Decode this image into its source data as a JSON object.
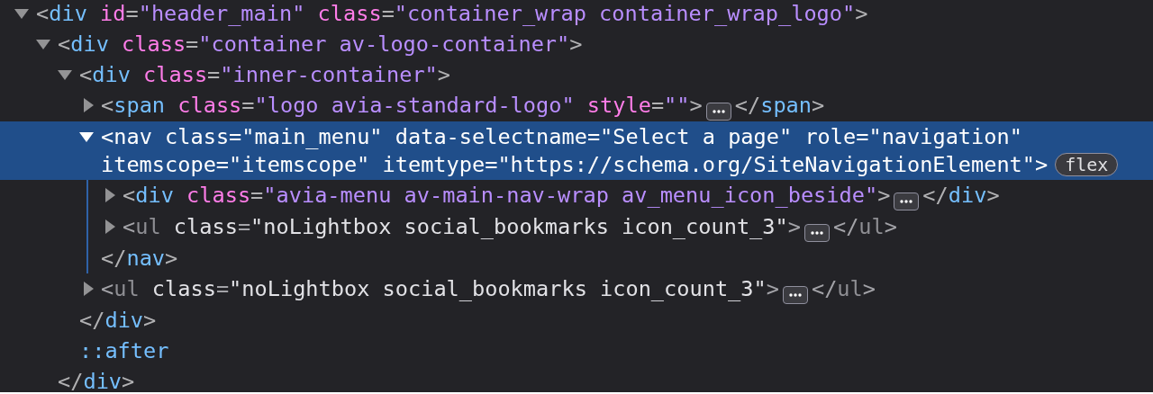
{
  "tree": [
    {
      "kind": "element",
      "lt": "<",
      "tag": "div",
      "gt": ">",
      "expanded": true,
      "selected": false,
      "dimmed": false,
      "attributes": [
        {
          "name": "id",
          "sign": "=",
          "value": "\"header_main\""
        },
        {
          "name": "class",
          "sign": "=",
          "value": "\"container_wrap container_wrap_logo\""
        }
      ],
      "children": [
        {
          "kind": "element",
          "lt": "<",
          "tag": "div",
          "gt": ">",
          "expanded": true,
          "selected": false,
          "dimmed": false,
          "attributes": [
            {
              "name": "class",
              "sign": "=",
              "value": "\"container av-logo-container\""
            }
          ],
          "closing": {
            "lt": "</",
            "tag": "div",
            "gt": ">"
          },
          "children": [
            {
              "kind": "element",
              "lt": "<",
              "tag": "div",
              "gt": ">",
              "expanded": true,
              "selected": false,
              "dimmed": false,
              "attributes": [
                {
                  "name": "class",
                  "sign": "=",
                  "value": "\"inner-container\""
                }
              ],
              "closing": {
                "lt": "</",
                "tag": "div",
                "gt": ">"
              },
              "children": [
                {
                  "kind": "element",
                  "lt": "<",
                  "tag": "span",
                  "gt": ">",
                  "expanded": false,
                  "selected": false,
                  "dimmed": false,
                  "attributes": [
                    {
                      "name": "class",
                      "sign": "=",
                      "value": "\"logo avia-standard-logo\""
                    },
                    {
                      "name": "style",
                      "sign": "=",
                      "value": "\"\""
                    }
                  ],
                  "closing": {
                    "lt": "</",
                    "tag": "span",
                    "gt": ">"
                  }
                },
                {
                  "kind": "element",
                  "lt": "<",
                  "tag": "nav",
                  "gt": ">",
                  "expanded": true,
                  "selected": true,
                  "dimmed": false,
                  "badge": "flex",
                  "attributes": [
                    {
                      "name": "class",
                      "sign": "=",
                      "value": "\"main_menu\""
                    },
                    {
                      "name": "data-selectname",
                      "sign": "=",
                      "value": "\"Select a page\""
                    },
                    {
                      "name": "role",
                      "sign": "=",
                      "value": "\"navigation\""
                    },
                    {
                      "name": "itemscope",
                      "sign": "=",
                      "value": "\"itemscope\""
                    },
                    {
                      "name": "itemtype",
                      "sign": "=",
                      "value": "\"https://schema.org/SiteNavigationElement\""
                    }
                  ],
                  "closing": {
                    "lt": "</",
                    "tag": "nav",
                    "gt": ">"
                  },
                  "children": [
                    {
                      "kind": "element",
                      "lt": "<",
                      "tag": "div",
                      "gt": ">",
                      "expanded": false,
                      "selected": false,
                      "dimmed": false,
                      "attributes": [
                        {
                          "name": "class",
                          "sign": "=",
                          "value": "\"avia-menu av-main-nav-wrap av_menu_icon_beside\""
                        }
                      ],
                      "closing": {
                        "lt": "</",
                        "tag": "div",
                        "gt": ">"
                      }
                    },
                    {
                      "kind": "element",
                      "lt": "<",
                      "tag": "ul",
                      "gt": ">",
                      "expanded": false,
                      "selected": false,
                      "dimmed": true,
                      "attributes": [
                        {
                          "name": "class",
                          "sign": "=",
                          "value": "\"noLightbox social_bookmarks icon_count_3\""
                        }
                      ],
                      "closing": {
                        "lt": "</",
                        "tag": "ul",
                        "gt": ">"
                      }
                    }
                  ]
                },
                {
                  "kind": "element",
                  "lt": "<",
                  "tag": "ul",
                  "gt": ">",
                  "expanded": false,
                  "selected": false,
                  "dimmed": true,
                  "attributes": [
                    {
                      "name": "class",
                      "sign": "=",
                      "value": "\"noLightbox social_bookmarks icon_count_3\""
                    }
                  ],
                  "closing": {
                    "lt": "</",
                    "tag": "ul",
                    "gt": ">"
                  }
                }
              ]
            },
            {
              "kind": "pseudo",
              "text": "::after"
            }
          ]
        }
      ]
    }
  ]
}
